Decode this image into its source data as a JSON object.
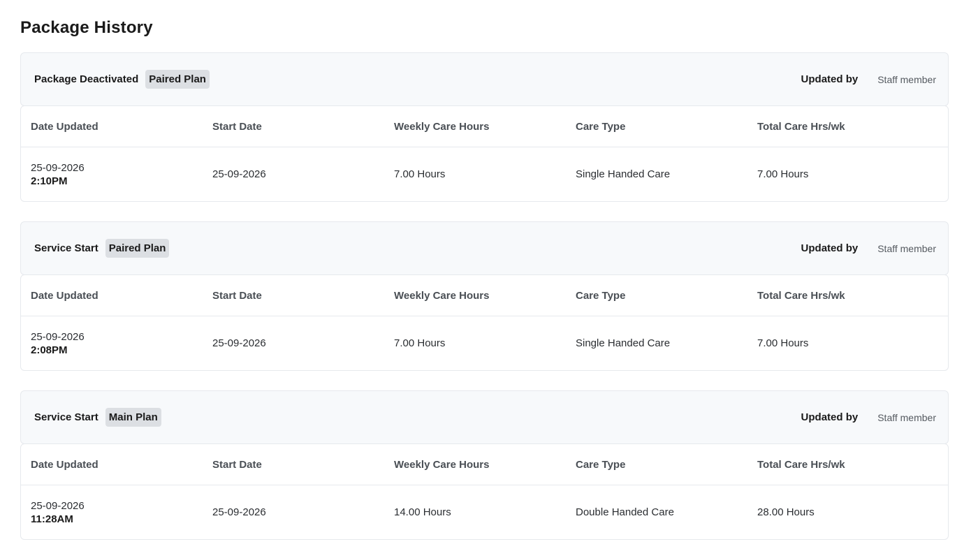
{
  "page": {
    "title": "Package History"
  },
  "columns": [
    "Date Updated",
    "Start Date",
    "Weekly Care Hours",
    "Care Type",
    "Total Care Hrs/wk"
  ],
  "updated_by_label": "Updated by",
  "entries": [
    {
      "event": "Package Deactivated",
      "plan": "Paired Plan",
      "updated_by": "Staff member",
      "date_updated": "25-09-2026",
      "time_updated": "2:10PM",
      "start_date": "25-09-2026",
      "weekly_care_hours": "7.00 Hours",
      "care_type": "Single Handed Care",
      "total_care_hrs_wk": "7.00 Hours"
    },
    {
      "event": "Service Start",
      "plan": "Paired Plan",
      "updated_by": "Staff member",
      "date_updated": "25-09-2026",
      "time_updated": "2:08PM",
      "start_date": "25-09-2026",
      "weekly_care_hours": "7.00 Hours",
      "care_type": "Single Handed Care",
      "total_care_hrs_wk": "7.00 Hours"
    },
    {
      "event": "Service Start",
      "plan": "Main Plan",
      "updated_by": "Staff member",
      "date_updated": "25-09-2026",
      "time_updated": "11:28AM",
      "start_date": "25-09-2026",
      "weekly_care_hours": "14.00 Hours",
      "care_type": "Double Handed Care",
      "total_care_hrs_wk": "28.00 Hours"
    }
  ]
}
